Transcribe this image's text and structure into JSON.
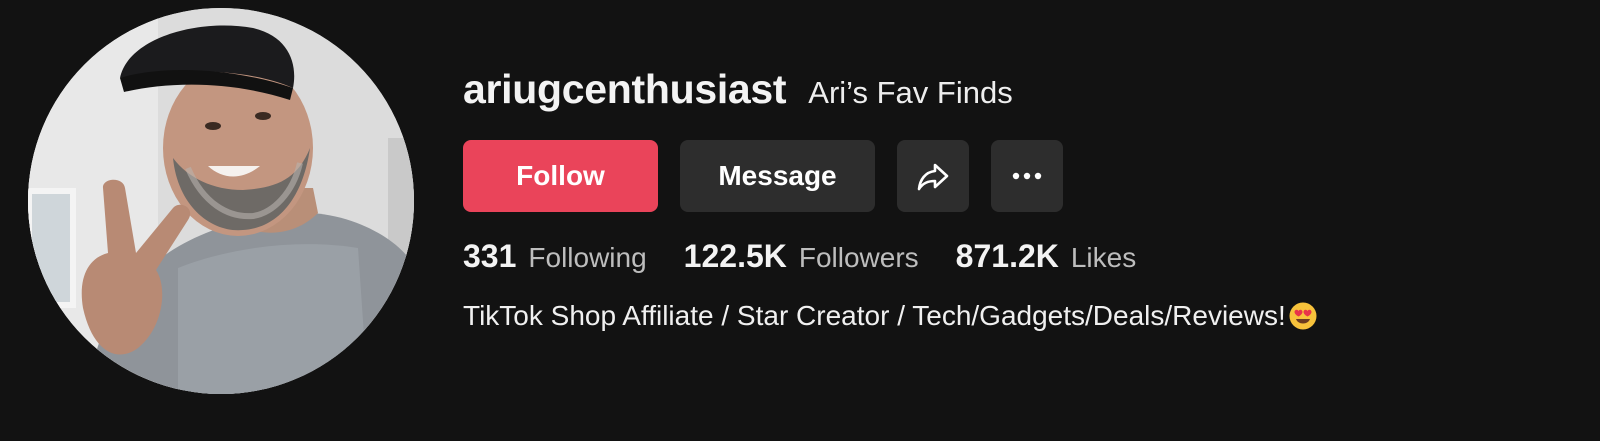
{
  "profile": {
    "username": "ariugcenthusiast",
    "nickname": "Ari’s Fav Finds",
    "avatar_alt": "profile-photo"
  },
  "actions": {
    "follow_label": "Follow",
    "message_label": "Message",
    "share_icon": "share-arrow-icon",
    "more_icon": "more-dots-icon"
  },
  "stats": [
    {
      "count": "331",
      "label": "Following"
    },
    {
      "count": "122.5K",
      "label": "Followers"
    },
    {
      "count": "871.2K",
      "label": "Likes"
    }
  ],
  "bio": {
    "text": "TikTok Shop Affiliate / Star Creator / Tech/Gadgets/Deals/Reviews!",
    "emoji": "heart-eyes-emoji"
  },
  "colors": {
    "background": "#121212",
    "follow_button": "#ea445a",
    "secondary_button": "#2d2d2d"
  }
}
